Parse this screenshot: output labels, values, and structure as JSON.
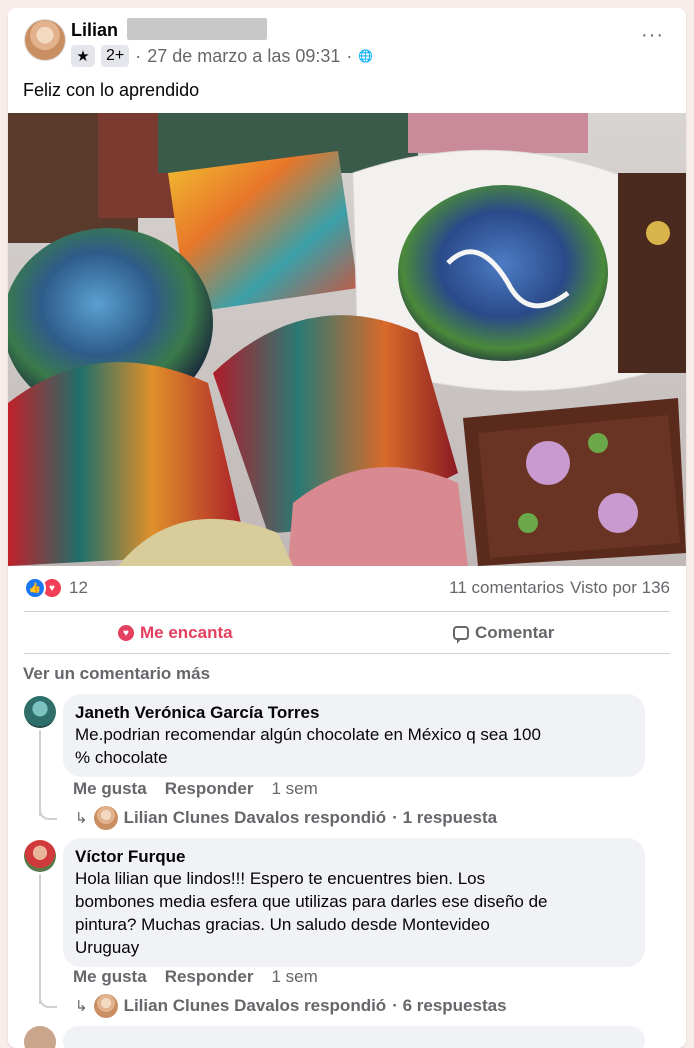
{
  "post": {
    "author": "Lilian",
    "badge_count": "2+",
    "timestamp": "27 de marzo a las 09:31",
    "audience_icon": "globe-icon",
    "more_icon": "more-options-icon",
    "text": "Feliz con lo aprendido",
    "photo_description_icon": "chocolate-bonbons-photo"
  },
  "reactions": {
    "count": "12",
    "comments": "11 comentarios",
    "seen": "Visto por 136",
    "types": [
      "like-icon",
      "love-icon"
    ]
  },
  "actions": {
    "love_label": "Me encanta",
    "comment_label": "Comentar"
  },
  "comments_section": {
    "view_more": "Ver un comentario más",
    "comments": [
      {
        "name": "Janeth Verónica García Torres",
        "text_line1": "Me.podrian recomendar algún chocolate en México q sea 100",
        "text_line2": "% chocolate",
        "like": "Me gusta",
        "reply": "Responder",
        "time": "1 sem",
        "replied_by": "Lilian Clunes Davalos respondió",
        "reply_count": "· 1 respuesta"
      },
      {
        "name": "Víctor Furque",
        "text_line1": "Hola lilian que lindos!!! Espero te encuentres bien. Los",
        "text_line2": "bombones media esfera que utilizas para darles ese diseño de",
        "text_line3": "pintura? Muchas gracias. Un saludo desde Montevideo",
        "text_line4": "Uruguay",
        "like": "Me gusta",
        "reply": "Responder",
        "time": "1 sem",
        "replied_by": "Lilian Clunes Davalos respondió",
        "reply_count": "· 6 respuestas"
      }
    ]
  },
  "colors": {
    "love": "#e4405f",
    "like": "#1877f2",
    "secondary_text": "#65676b",
    "bubble": "#f0f2f5"
  }
}
